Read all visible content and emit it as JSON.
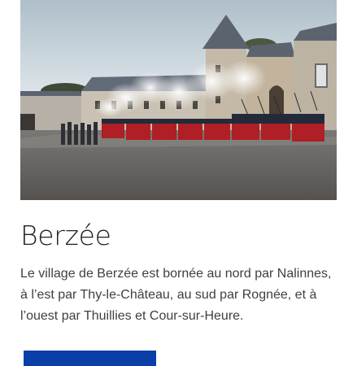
{
  "hero": {
    "image_name": "berzee-castle-photo"
  },
  "content": {
    "title": "Berzée",
    "description": "Le village de Berzée est bornée au nord par Nalinnes, à l’est par Thy-le-Château, au sud par Rognée, et à l’ouest par Thuillies et Cour-sur-Heure."
  },
  "cta": {
    "label": ""
  },
  "colors": {
    "button": "#0a3ea8",
    "title": "#202020",
    "text": "#3f3f3f"
  }
}
